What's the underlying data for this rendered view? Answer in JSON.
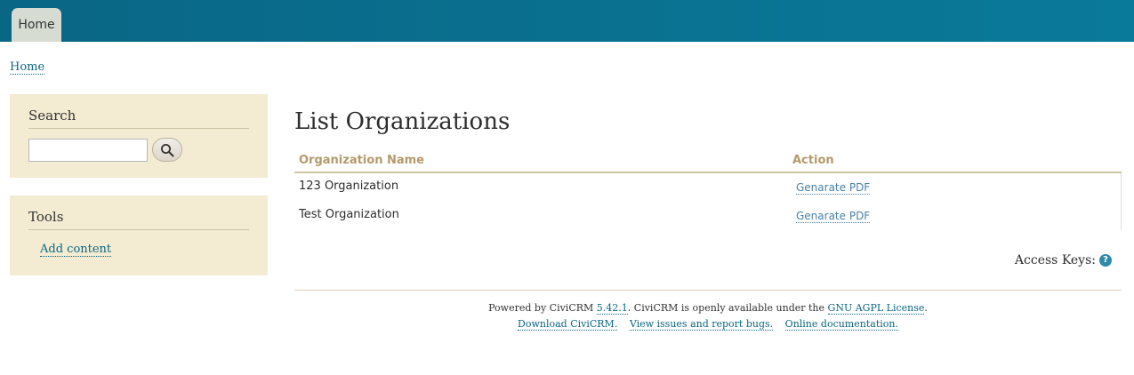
{
  "nav": {
    "home_tab": "Home"
  },
  "breadcrumb": {
    "home": "Home"
  },
  "sidebar": {
    "search": {
      "title": "Search",
      "input_value": ""
    },
    "tools": {
      "title": "Tools",
      "add_content": "Add content"
    }
  },
  "main": {
    "title": "List Organizations",
    "columns": {
      "name": "Organization Name",
      "action": "Action"
    },
    "rows": [
      {
        "name": "123 Organization",
        "action": "Genarate PDF"
      },
      {
        "name": "Test Organization",
        "action": "Genarate PDF"
      }
    ],
    "access_keys": "Access Keys:"
  },
  "footer": {
    "powered_prefix": "Powered by CiviCRM ",
    "version": "5.42.1",
    "powered_mid": ". CiviCRM is openly available under the ",
    "license": "GNU AGPL License",
    "powered_suffix": ".",
    "download": "Download CiviCRM.",
    "issues": "View issues and report bugs.",
    "docs": "Online documentation."
  },
  "colors": {
    "topbar": "#0a7a9a",
    "sidebar_block": "#f3ebd2",
    "link": "#0a6685",
    "column_header": "#b39a6c"
  },
  "icons": {
    "search_button": "search-icon",
    "access_keys_help": "help-icon"
  }
}
